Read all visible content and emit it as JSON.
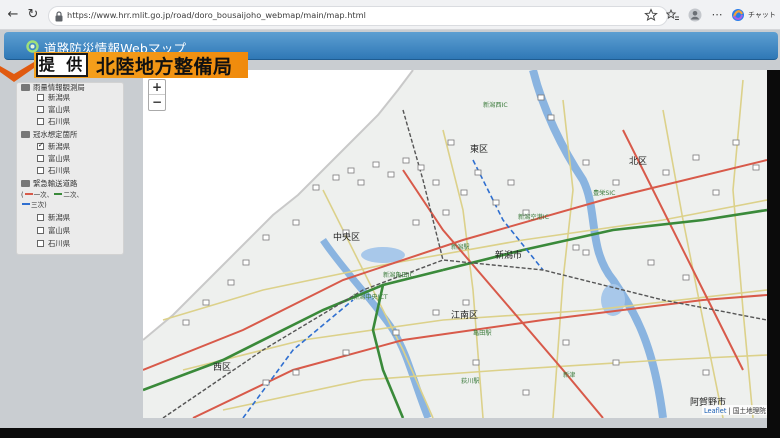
{
  "browser": {
    "url": "https://www.hrr.mlit.go.jp/road/doro_bousaijoho_webmap/main/map.html",
    "copilot_label": "チャット"
  },
  "app": {
    "title": "道路防災情報Webマップ"
  },
  "caption": {
    "label": "提 供",
    "text": "北陸地方整備局"
  },
  "layers": {
    "group1_title": "雨量情報観測局",
    "group1_items": [
      {
        "label": "新潟県",
        "checked": false
      },
      {
        "label": "富山県",
        "checked": false
      },
      {
        "label": "石川県",
        "checked": false
      }
    ],
    "group2_title": "冠水想定箇所",
    "group2_items": [
      {
        "label": "新潟県",
        "checked": true
      },
      {
        "label": "富山県",
        "checked": false
      },
      {
        "label": "石川県",
        "checked": false
      }
    ],
    "group3_title": "緊急輸送道路",
    "legend_line1a": "(",
    "legend_line1b": "一次、",
    "legend_line1c": "二次、",
    "legend_line2": "三次)",
    "group3_items": [
      {
        "label": "新潟県",
        "checked": false
      },
      {
        "label": "富山県",
        "checked": false
      },
      {
        "label": "石川県",
        "checked": false
      }
    ]
  },
  "map": {
    "zoom_in": "+",
    "zoom_out": "−",
    "labels": {
      "higashi_ku": "東区",
      "kita_ku": "北区",
      "chuo_ku": "中央区",
      "niigata_city": "新潟市",
      "konan_ku": "江南区",
      "nishi_ku": "西区",
      "agano_city": "阿賀野市",
      "niigata_nishi_ic": "新潟西IC",
      "niigata_chuo_jct": "新潟中央JCT",
      "niigata_kameda_ic": "新潟亀田IC",
      "niigata_airport": "新潟空港IC",
      "niigata_eki": "新潟駅",
      "kameda_eki": "亀田駅",
      "ogino_eki": "荻川駅",
      "toyosaka": "豊栄SIC",
      "niitsu": "新津"
    },
    "attribution_link": "Leaflet",
    "attribution_text": "| 国土地理院"
  },
  "colors": {
    "header_blue": "#2f78b6",
    "caption_orange": "#f5a520",
    "road_green": "#3a8a3a",
    "road_red": "#d85a4a",
    "river_blue": "#8ab4e0",
    "sea": "#ffffff"
  }
}
